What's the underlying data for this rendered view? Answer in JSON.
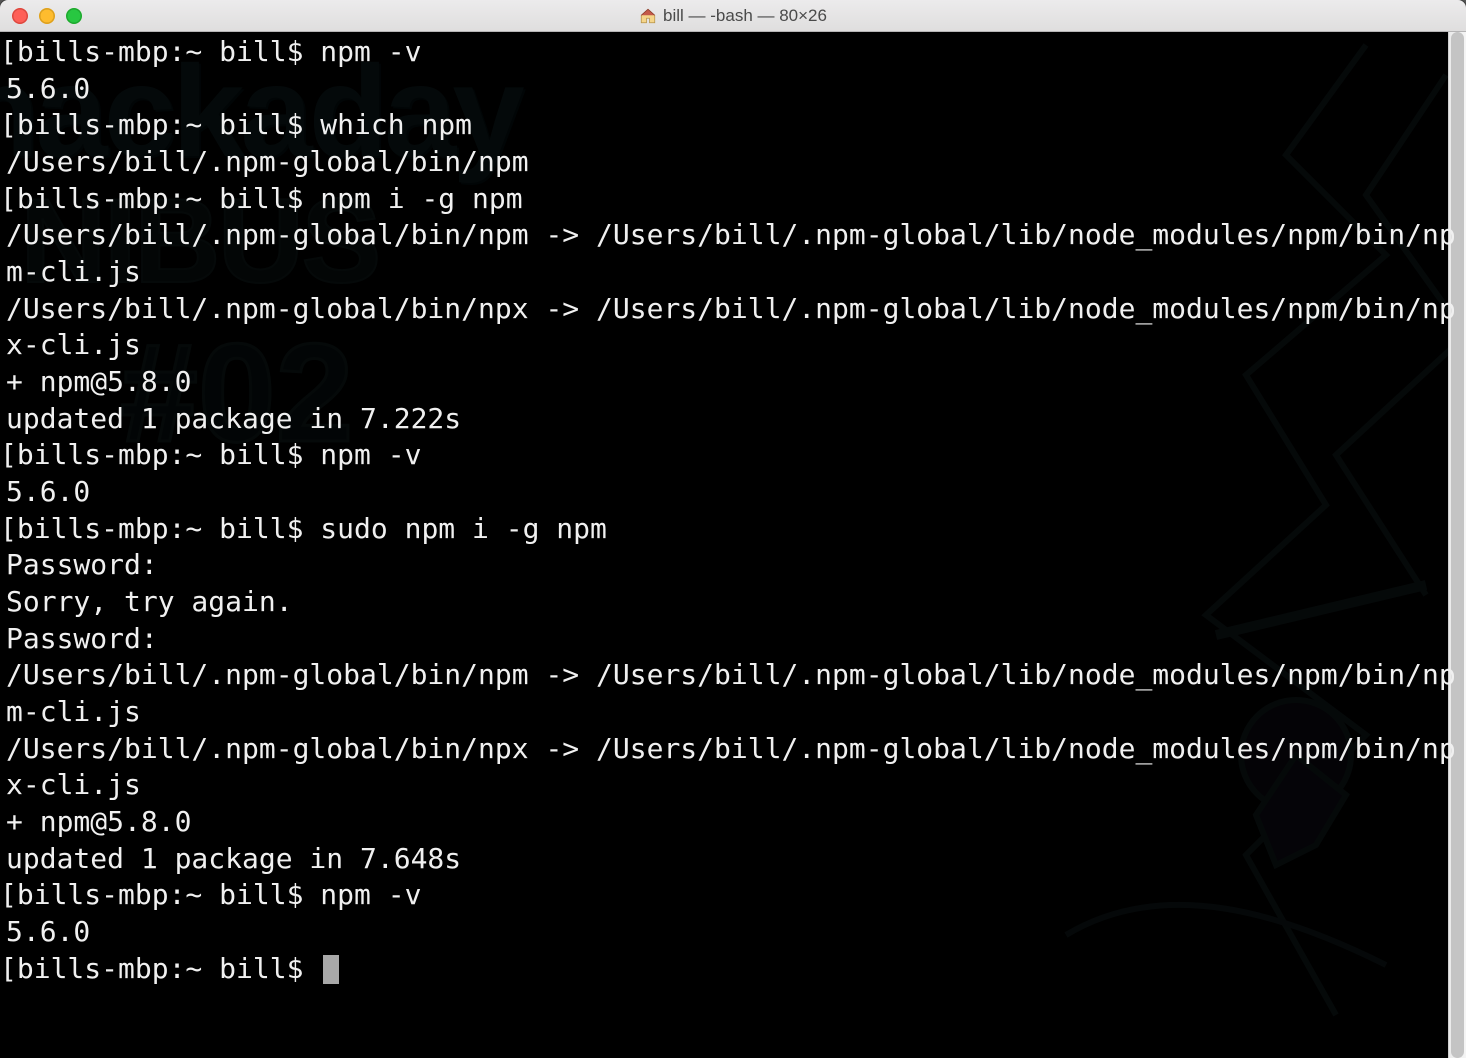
{
  "window": {
    "title": "bill — -bash — 80×26"
  },
  "prompt": "bills-mbp:~ bill$",
  "bg": {
    "word1": "hackaday",
    "word2": "NIBUS",
    "num": "#02"
  },
  "lines": [
    {
      "kind": "prompt",
      "cmd": "npm -v"
    },
    {
      "kind": "out",
      "text": "5.6.0"
    },
    {
      "kind": "prompt",
      "cmd": "which npm"
    },
    {
      "kind": "out",
      "text": "/Users/bill/.npm-global/bin/npm"
    },
    {
      "kind": "prompt",
      "cmd": "npm i -g npm"
    },
    {
      "kind": "out",
      "text": "/Users/bill/.npm-global/bin/npm -> /Users/bill/.npm-global/lib/node_modules/npm/bin/npm-cli.js"
    },
    {
      "kind": "out",
      "text": "/Users/bill/.npm-global/bin/npx -> /Users/bill/.npm-global/lib/node_modules/npm/bin/npx-cli.js"
    },
    {
      "kind": "out",
      "text": "+ npm@5.8.0"
    },
    {
      "kind": "out",
      "text": "updated 1 package in 7.222s"
    },
    {
      "kind": "prompt",
      "cmd": "npm -v"
    },
    {
      "kind": "out",
      "text": "5.6.0"
    },
    {
      "kind": "prompt",
      "cmd": "sudo npm i -g npm"
    },
    {
      "kind": "out",
      "text": "Password:"
    },
    {
      "kind": "out",
      "text": "Sorry, try again."
    },
    {
      "kind": "out",
      "text": "Password:"
    },
    {
      "kind": "out",
      "text": "/Users/bill/.npm-global/bin/npm -> /Users/bill/.npm-global/lib/node_modules/npm/bin/npm-cli.js"
    },
    {
      "kind": "out",
      "text": "/Users/bill/.npm-global/bin/npx -> /Users/bill/.npm-global/lib/node_modules/npm/bin/npx-cli.js"
    },
    {
      "kind": "out",
      "text": "+ npm@5.8.0"
    },
    {
      "kind": "out",
      "text": "updated 1 package in 7.648s"
    },
    {
      "kind": "prompt",
      "cmd": "npm -v"
    },
    {
      "kind": "out",
      "text": "5.6.0"
    },
    {
      "kind": "prompt",
      "cmd": "",
      "cursor": true
    }
  ]
}
